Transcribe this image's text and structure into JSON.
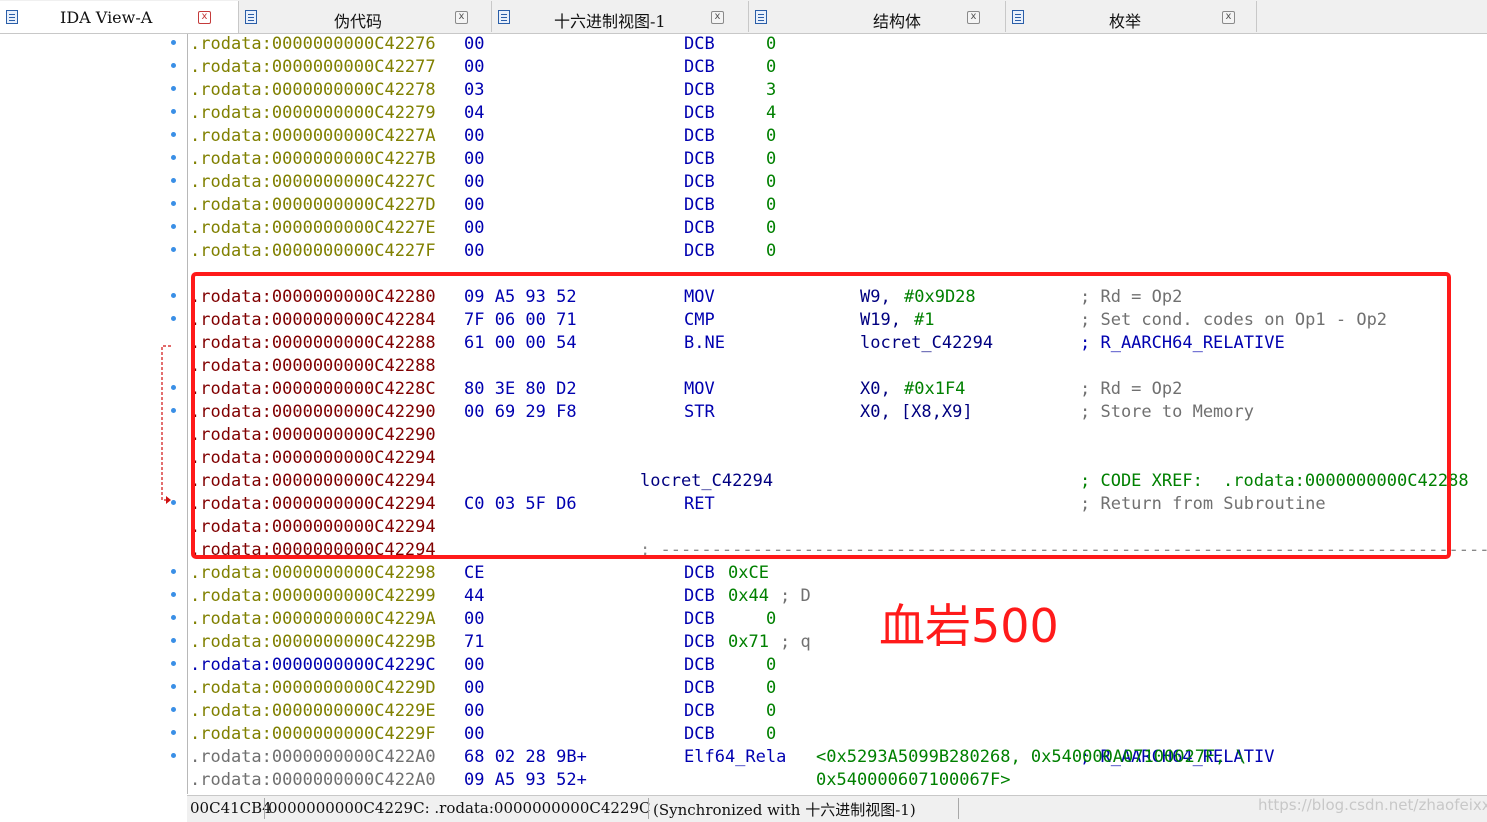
{
  "tabs": [
    {
      "label": "IDA View-A",
      "icon": "listing-icon",
      "active": true
    },
    {
      "label": "伪代码",
      "icon": "pseudocode-icon",
      "active": false
    },
    {
      "label": "十六进制视图-1",
      "icon": "hex-view-icon",
      "active": false
    },
    {
      "label": "结构体",
      "icon": "structures-icon",
      "active": false
    },
    {
      "label": "枚举",
      "icon": "enums-icon",
      "active": false
    }
  ],
  "close_glyph": "x",
  "listing": [
    {
      "addr": ".rodata:0000000000C42276",
      "addr_color": "olive",
      "bytes": "00",
      "mnemonic": "DCB",
      "operand": "0"
    },
    {
      "addr": ".rodata:0000000000C42277",
      "addr_color": "olive",
      "bytes": "00",
      "mnemonic": "DCB",
      "operand": "0"
    },
    {
      "addr": ".rodata:0000000000C42278",
      "addr_color": "olive",
      "bytes": "03",
      "mnemonic": "DCB",
      "operand": "3"
    },
    {
      "addr": ".rodata:0000000000C42279",
      "addr_color": "olive",
      "bytes": "04",
      "mnemonic": "DCB",
      "operand": "4"
    },
    {
      "addr": ".rodata:0000000000C4227A",
      "addr_color": "olive",
      "bytes": "00",
      "mnemonic": "DCB",
      "operand": "0"
    },
    {
      "addr": ".rodata:0000000000C4227B",
      "addr_color": "olive",
      "bytes": "00",
      "mnemonic": "DCB",
      "operand": "0"
    },
    {
      "addr": ".rodata:0000000000C4227C",
      "addr_color": "olive",
      "bytes": "00",
      "mnemonic": "DCB",
      "operand": "0"
    },
    {
      "addr": ".rodata:0000000000C4227D",
      "addr_color": "olive",
      "bytes": "00",
      "mnemonic": "DCB",
      "operand": "0"
    },
    {
      "addr": ".rodata:0000000000C4227E",
      "addr_color": "olive",
      "bytes": "00",
      "mnemonic": "DCB",
      "operand": "0"
    },
    {
      "addr": ".rodata:0000000000C4227F",
      "addr_color": "olive",
      "bytes": "00",
      "mnemonic": "DCB",
      "operand": "0"
    },
    {
      "addr": ".rodata:0000000000C42280",
      "addr_color": "maroon",
      "separator": ";",
      "partial": true
    },
    {
      "addr": ".rodata:0000000000C42280",
      "addr_color": "maroon",
      "bytes": "09 A5 93 52",
      "mnemonic": "MOV",
      "op1": "W9,",
      "op2": "#0x9D28",
      "comment": "; Rd = Op2"
    },
    {
      "addr": ".rodata:0000000000C42284",
      "addr_color": "maroon",
      "bytes": "7F 06 00 71",
      "mnemonic": "CMP",
      "op1": "W19,",
      "op2": "#1",
      "comment": "; Set cond. codes on Op1 - Op2"
    },
    {
      "addr": ".rodata:0000000000C42288",
      "addr_color": "maroon",
      "bytes": "61 00 00 54",
      "mnemonic": "B.NE",
      "op1": "locret_C42294",
      "comment_blue": "; R_AARCH64_RELATIVE"
    },
    {
      "addr": ".rodata:0000000000C42288",
      "addr_color": "maroon"
    },
    {
      "addr": ".rodata:0000000000C4228C",
      "addr_color": "maroon",
      "bytes": "80 3E 80 D2",
      "mnemonic": "MOV",
      "op1": "X0,",
      "op2": "#0x1F4",
      "comment": "; Rd = Op2"
    },
    {
      "addr": ".rodata:0000000000C42290",
      "addr_color": "maroon",
      "bytes": "00 69 29 F8",
      "mnemonic": "STR",
      "op1": "X0, [X8,X9]",
      "comment": "; Store to Memory"
    },
    {
      "addr": ".rodata:0000000000C42290",
      "addr_color": "maroon"
    },
    {
      "addr": ".rodata:0000000000C42294",
      "addr_color": "maroon"
    },
    {
      "addr": ".rodata:0000000000C42294",
      "addr_color": "maroon",
      "label": "locret_C42294",
      "xref_prefix": "; CODE XREF: ",
      "xref_target": ".rodata:0000000000C42288"
    },
    {
      "addr": ".rodata:0000000000C42294",
      "addr_color": "maroon",
      "bytes": "C0 03 5F D6",
      "mnemonic": "RET",
      "comment": "; Return from Subroutine"
    },
    {
      "addr": ".rodata:0000000000C42294",
      "addr_color": "maroon"
    },
    {
      "addr": ".rodata:0000000000C42294",
      "addr_color": "maroon",
      "separator": "; -----------------------------------------------------------------------------------------"
    },
    {
      "addr": ".rodata:0000000000C42298",
      "addr_color": "olive",
      "bytes": "CE",
      "mnemonic": "DCB",
      "operand_hex": "0xCE"
    },
    {
      "addr": ".rodata:0000000000C42299",
      "addr_color": "olive",
      "bytes": "44",
      "mnemonic": "DCB",
      "operand_hex": "0x44",
      "comment": "; D"
    },
    {
      "addr": ".rodata:0000000000C4229A",
      "addr_color": "olive",
      "bytes": "00",
      "mnemonic": "DCB",
      "operand": "0"
    },
    {
      "addr": ".rodata:0000000000C4229B",
      "addr_color": "olive",
      "bytes": "71",
      "mnemonic": "DCB",
      "operand_hex": "0x71",
      "comment": "; q"
    },
    {
      "addr": ".rodata:0000000000C4229C",
      "addr_color": "blue",
      "bytes": "00",
      "mnemonic": "DCB",
      "operand": "0"
    },
    {
      "addr": ".rodata:0000000000C4229D",
      "addr_color": "olive",
      "bytes": "00",
      "mnemonic": "DCB",
      "operand": "0"
    },
    {
      "addr": ".rodata:0000000000C4229E",
      "addr_color": "olive",
      "bytes": "00",
      "mnemonic": "DCB",
      "operand": "0"
    },
    {
      "addr": ".rodata:0000000000C4229F",
      "addr_color": "olive",
      "bytes": "00",
      "mnemonic": "DCB",
      "operand": "0"
    },
    {
      "addr": ".rodata:0000000000C422A0",
      "addr_color": "gray",
      "bytes": "68 02 28 9B+",
      "mnemonic": "Elf64_Rela",
      "rela_text": "<0x5293A5099B280268, 0x540000A07100027F, \\",
      "comment_blue": "; R_AARCH64_RELATIV"
    },
    {
      "addr": ".rodata:0000000000C422A0",
      "addr_color": "gray",
      "bytes": "09 A5 93 52+",
      "rela_text": "0x540000607100067F>"
    }
  ],
  "annotation": "血岩500",
  "status": {
    "offset": "00C41CB4",
    "location": "0000000000C4229C: .rodata:0000000000C4229C",
    "sync": "(Synchronized with 十六进制视图-1)"
  },
  "watermark": "https://blog.csdn.net/zhaofeixxx",
  "colors": {
    "highlight": "#ff1a1a",
    "annotation": "#ff1a1a",
    "address_olive": "#808000",
    "address_maroon": "#800000",
    "opcode_blue": "#0000b0",
    "number_green": "#008000"
  }
}
